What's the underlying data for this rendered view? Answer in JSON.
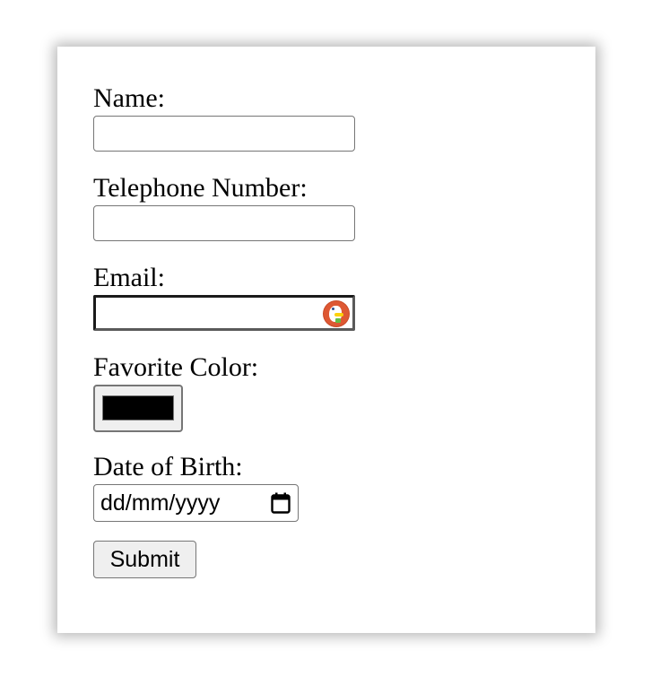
{
  "form": {
    "name_label": "Name:",
    "name_value": "",
    "phone_label": "Telephone Number:",
    "phone_value": "",
    "email_label": "Email:",
    "email_value": "",
    "email_autofill_icon": "duckduckgo-icon",
    "color_label": "Favorite Color:",
    "color_value": "#000000",
    "dob_label": "Date of Birth:",
    "dob_placeholder": "dd/mm/yyyy",
    "dob_icon": "calendar-icon",
    "submit_label": "Submit"
  }
}
